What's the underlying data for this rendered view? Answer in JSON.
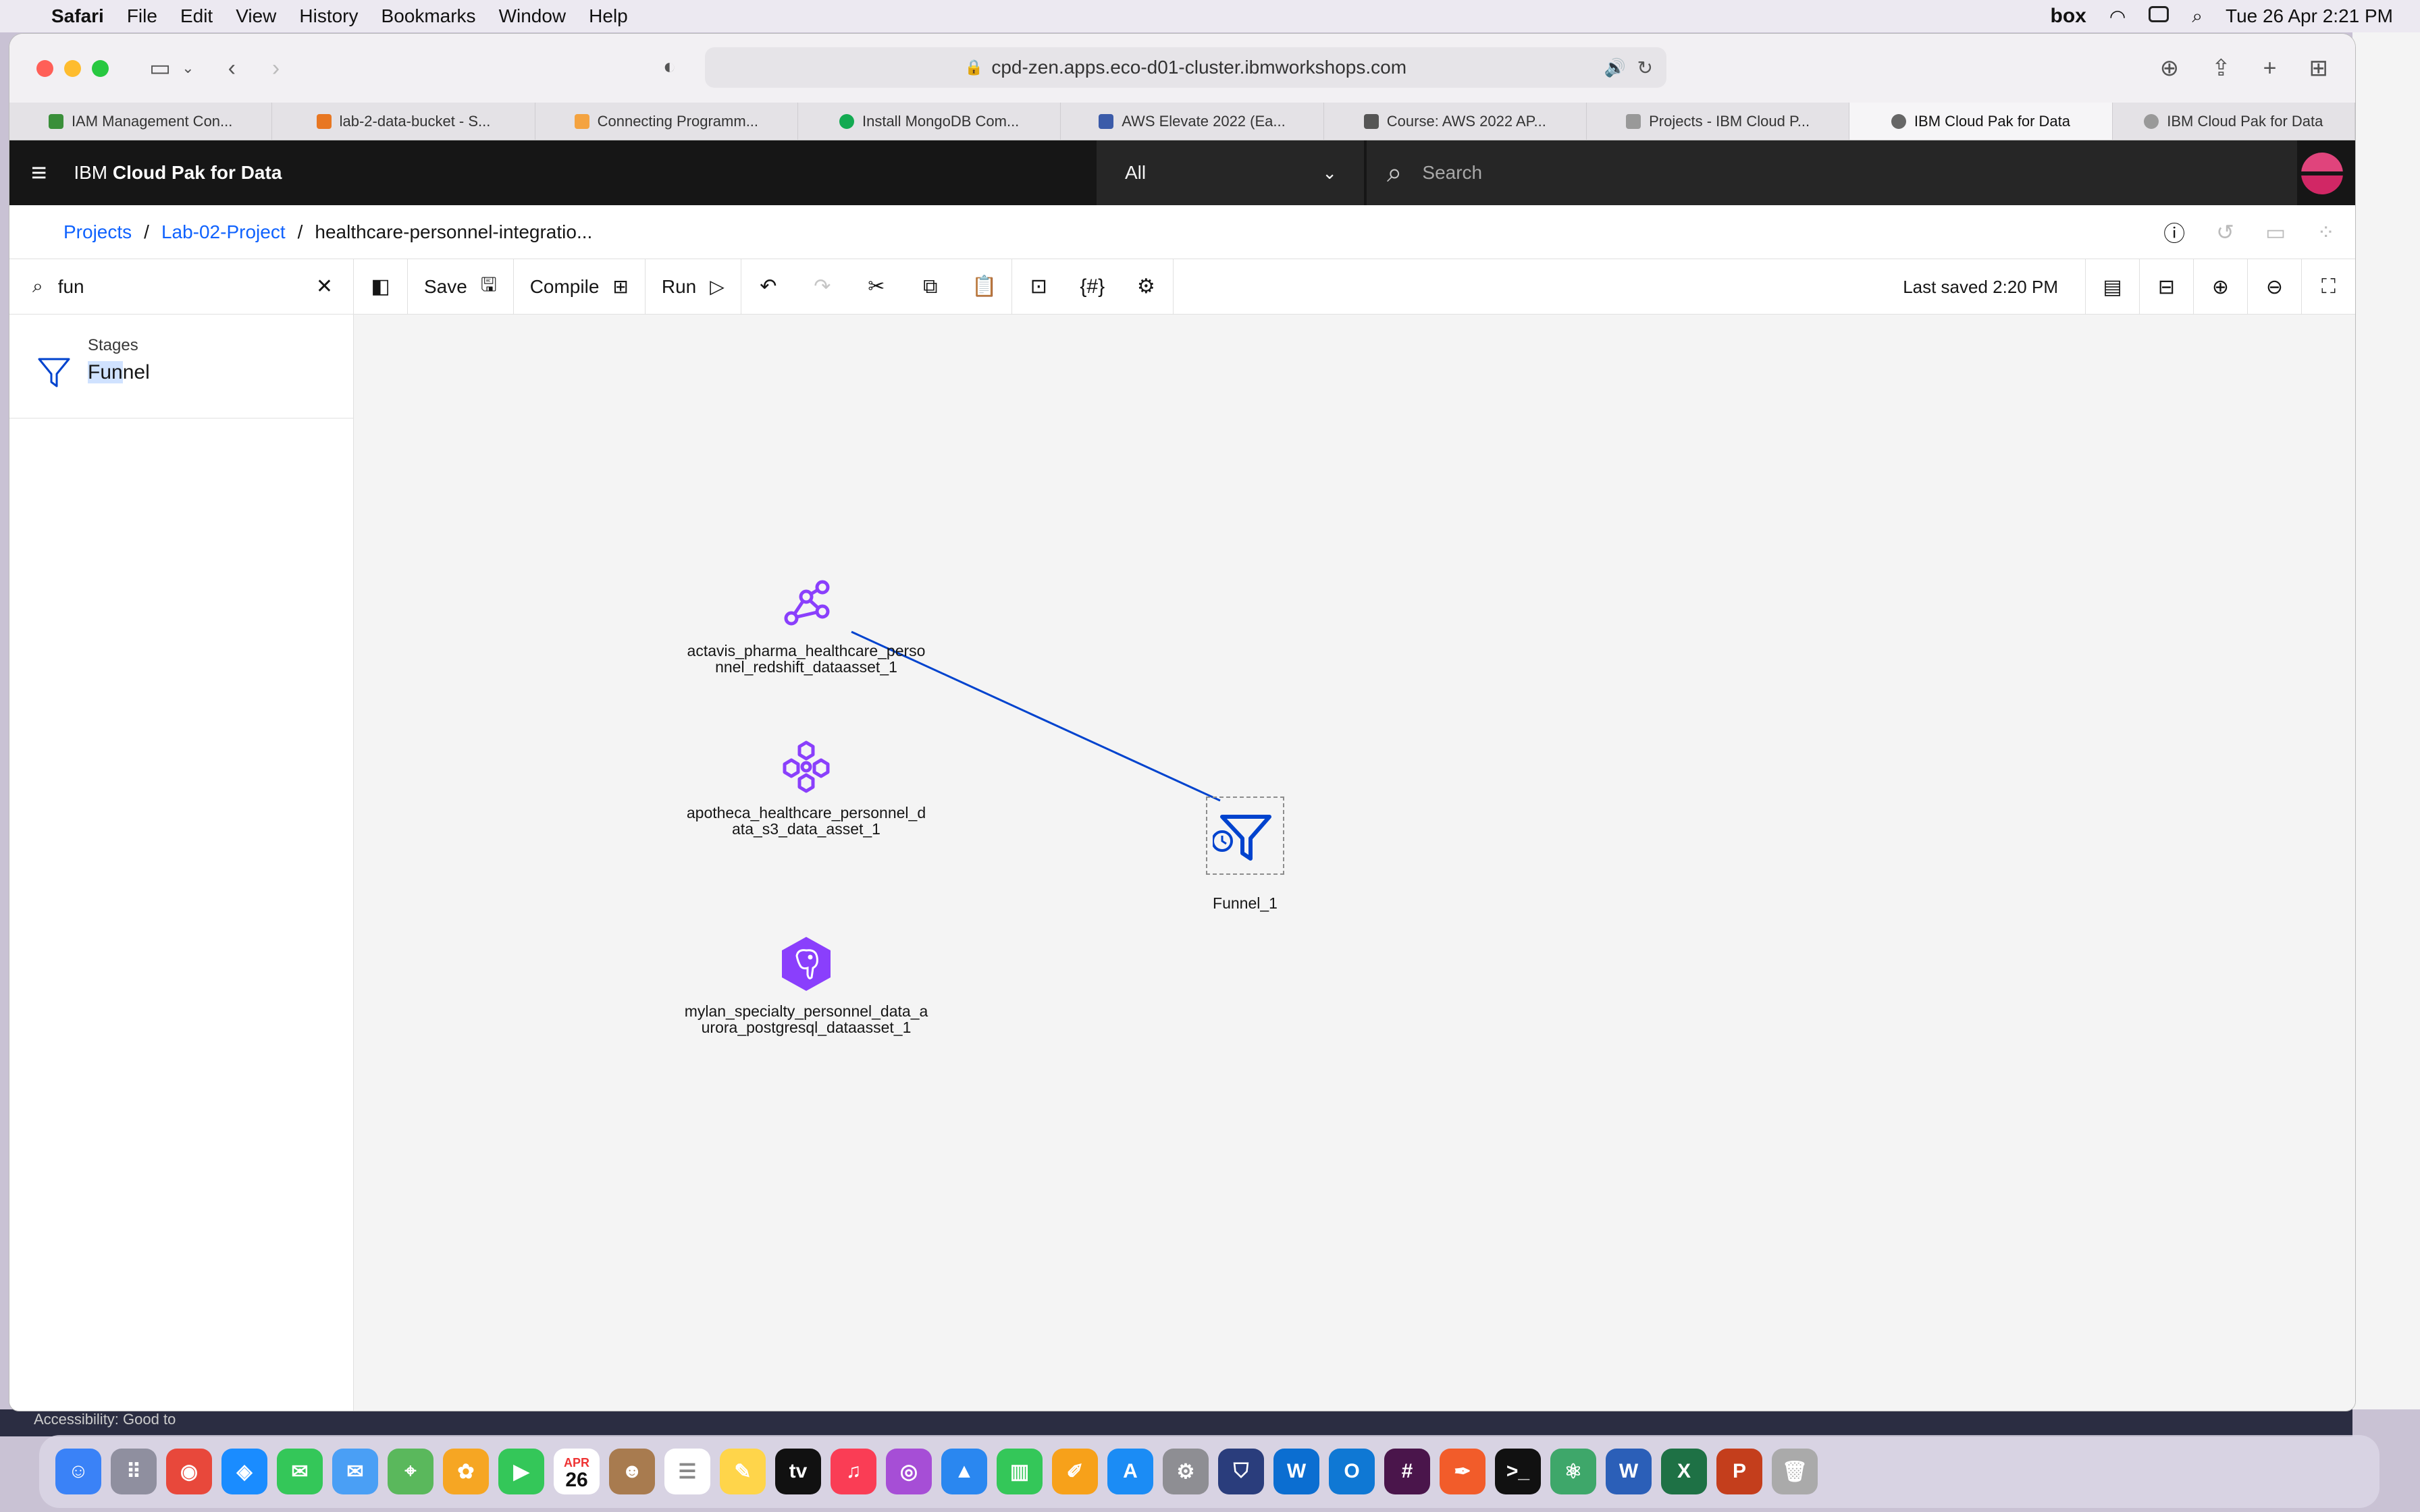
{
  "menubar": {
    "app": "Safari",
    "items": [
      "File",
      "Edit",
      "View",
      "History",
      "Bookmarks",
      "Window",
      "Help"
    ],
    "clock": "Tue 26 Apr  2:21 PM",
    "box": "box"
  },
  "browser": {
    "url": "cpd-zen.apps.eco-d01-cluster.ibmworkshops.com",
    "tabs": [
      {
        "label": "IAM Management Con...",
        "color": "#3a8f3a"
      },
      {
        "label": "lab-2-data-bucket - S...",
        "color": "#e87722"
      },
      {
        "label": "Connecting Programm...",
        "color": "#f4a340"
      },
      {
        "label": "Install MongoDB Com...",
        "color": "#13aa52"
      },
      {
        "label": "AWS Elevate 2022 (Ea...",
        "color": "#3b5ba9"
      },
      {
        "label": "Course: AWS 2022 AP...",
        "color": "#555"
      },
      {
        "label": "Projects - IBM Cloud P...",
        "color": "#999"
      },
      {
        "label": "IBM Cloud Pak for Data",
        "color": "#666"
      },
      {
        "label": "IBM Cloud Pak for Data",
        "color": "#999"
      }
    ]
  },
  "ibm": {
    "title_prefix": "IBM",
    "title_bold": "Cloud Pak for Data",
    "scope": "All",
    "search_placeholder": "Search"
  },
  "breadcrumb": {
    "projects": "Projects",
    "project": "Lab-02-Project",
    "flow": "healthcare-personnel-integratio..."
  },
  "toolbar": {
    "save": "Save",
    "compile": "Compile",
    "run": "Run",
    "last_saved": "Last saved 2:20 PM"
  },
  "palette": {
    "search_value": "fun",
    "section": "Stages",
    "item_highlight": "Fun",
    "item_rest": "nel"
  },
  "nodes": {
    "redshift_l1": "actavis_pharma_healthcare_perso",
    "redshift_l2": "nnel_redshift_dataasset_1",
    "s3_l1": "apotheca_healthcare_personnel_d",
    "s3_l2": "ata_s3_data_asset_1",
    "pg_l1": "mylan_specialty_personnel_data_a",
    "pg_l2": "urora_postgresql_dataasset_1",
    "funnel": "Funnel_1"
  },
  "status": {
    "accessibility": "Accessibility: Good to"
  },
  "dock_calendar": {
    "month": "APR",
    "day": "26"
  },
  "colors": {
    "ibm_blue": "#0f62fe",
    "node_purple": "#8a3ffc",
    "funnel_blue": "#0043ce"
  }
}
